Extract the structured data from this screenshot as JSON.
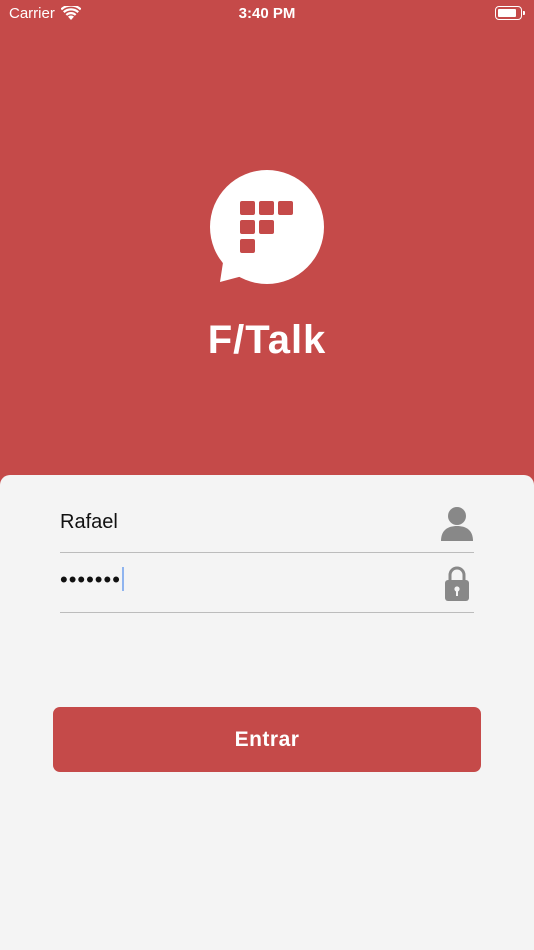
{
  "status_bar": {
    "carrier": "Carrier",
    "time": "3:40 PM"
  },
  "app": {
    "name": "F/Talk",
    "brand_color": "#c54a49"
  },
  "login": {
    "username_value": "Rafael",
    "password_value": "•••••••",
    "submit_label": "Entrar"
  },
  "icons": [
    "wifi-icon",
    "battery-icon",
    "app-logo",
    "user-icon",
    "lock-icon"
  ]
}
